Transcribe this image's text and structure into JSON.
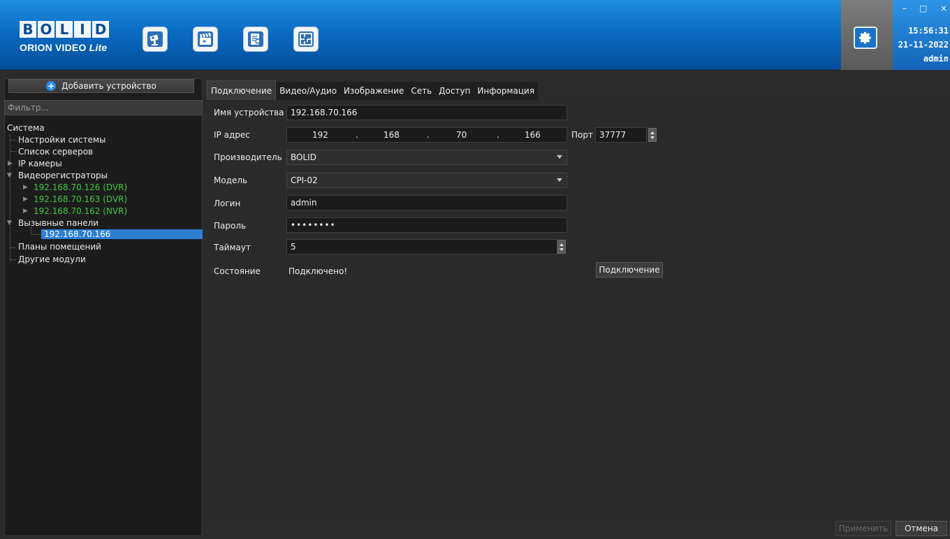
{
  "header": {
    "logo_top": "BOLID",
    "logo_brand": "ORION VIDEO",
    "logo_suffix": "Lite",
    "nav_icons": [
      "camera-icon",
      "clapperboard-icon",
      "document-search-icon",
      "floor-plan-icon"
    ],
    "settings_icon": "gear-icon",
    "window_controls": {
      "minimize": "–",
      "maximize": "□",
      "close": "×"
    },
    "time": "15:56:31",
    "date": "21-11-2022",
    "user": "admin"
  },
  "sidebar": {
    "add_device_label": "Добавить устройство",
    "filter_placeholder": "Фильтр...",
    "tree": {
      "root": "Система",
      "system_settings": "Настройки системы",
      "server_list": "Список серверов",
      "ip_cameras": "IP камеры",
      "dvrs": "Видеорегистраторы",
      "dvr_items": [
        "192.168.70.126 (DVR)",
        "192.168.70.163 (DVR)",
        "192.168.70.162 (NVR)"
      ],
      "call_panels": "Вызывные панели",
      "call_panel_selected": "192.168.70.166",
      "floor_plans": "Планы помещений",
      "other_modules": "Другие модули"
    }
  },
  "tabs": [
    "Подключение",
    "Видео/Аудио",
    "Изображение",
    "Сеть",
    "Доступ",
    "Информация"
  ],
  "form": {
    "device_name_label": "Имя устройства",
    "device_name_value": "192.168.70.166",
    "ip_label": "IP адрес",
    "ip_octets": [
      "192",
      "168",
      "70",
      "166"
    ],
    "ip_separator": ".",
    "port_label": "Порт",
    "port_value": "37777",
    "manufacturer_label": "Производитель",
    "manufacturer_value": "BOLID",
    "model_label": "Модель",
    "model_value": "CPI-02",
    "login_label": "Логин",
    "login_value": "admin",
    "password_label": "Пароль",
    "password_value": "••••••••",
    "timeout_label": "Таймаут",
    "timeout_value": "5",
    "status_label": "Состояние",
    "status_value": "Подключено!",
    "connect_button": "Подключение"
  },
  "footer": {
    "apply_label": "Применить",
    "cancel_label": "Отмена"
  },
  "colors": {
    "header_blue": "#0a6cc4",
    "selection_blue": "#2d7fd2",
    "online_green": "#44c844",
    "background": "#2b2b2b"
  }
}
